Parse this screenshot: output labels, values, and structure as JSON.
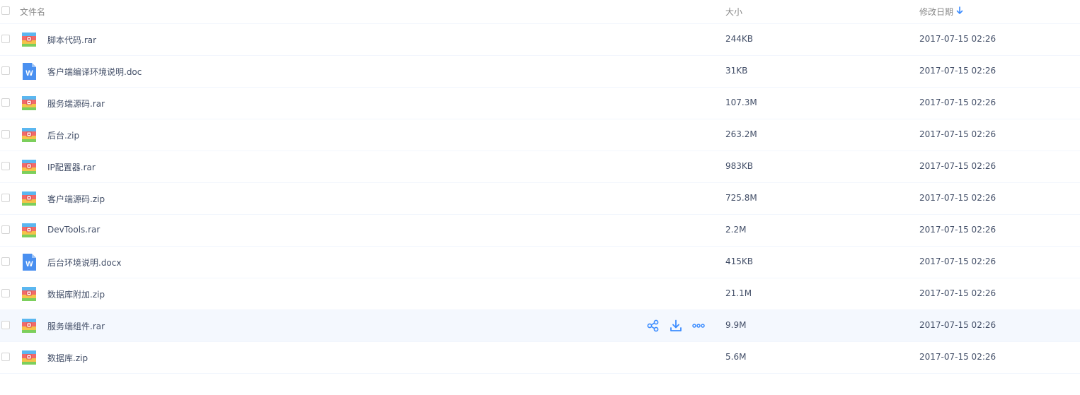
{
  "header": {
    "name_label": "文件名",
    "size_label": "大小",
    "date_label": "修改日期"
  },
  "colors": {
    "accent": "#3b8cff",
    "row_hover": "#f4f8fe",
    "text": "#424e67",
    "header_text": "#888888"
  },
  "files": [
    {
      "name": "脚本代码.rar",
      "icon": "archive-icon",
      "size": "244KB",
      "date": "2017-07-15 02:26"
    },
    {
      "name": "客户端编译环境说明.doc",
      "icon": "word-doc-icon",
      "size": "31KB",
      "date": "2017-07-15 02:26"
    },
    {
      "name": "服务端源码.rar",
      "icon": "archive-icon",
      "size": "107.3M",
      "date": "2017-07-15 02:26"
    },
    {
      "name": "后台.zip",
      "icon": "archive-icon",
      "size": "263.2M",
      "date": "2017-07-15 02:26"
    },
    {
      "name": "IP配置器.rar",
      "icon": "archive-icon",
      "size": "983KB",
      "date": "2017-07-15 02:26"
    },
    {
      "name": "客户端源码.zip",
      "icon": "archive-icon",
      "size": "725.8M",
      "date": "2017-07-15 02:26"
    },
    {
      "name": "DevTools.rar",
      "icon": "archive-icon",
      "size": "2.2M",
      "date": "2017-07-15 02:26"
    },
    {
      "name": "后台环境说明.docx",
      "icon": "word-doc-icon",
      "size": "415KB",
      "date": "2017-07-15 02:26"
    },
    {
      "name": "数据库附加.zip",
      "icon": "archive-icon",
      "size": "21.1M",
      "date": "2017-07-15 02:26"
    },
    {
      "name": "服务端组件.rar",
      "icon": "archive-icon",
      "size": "9.9M",
      "date": "2017-07-15 02:26",
      "hovered": true
    },
    {
      "name": "数据库.zip",
      "icon": "archive-icon",
      "size": "5.6M",
      "date": "2017-07-15 02:26"
    }
  ],
  "row_actions": [
    "share-icon",
    "download-icon",
    "more-icon"
  ]
}
